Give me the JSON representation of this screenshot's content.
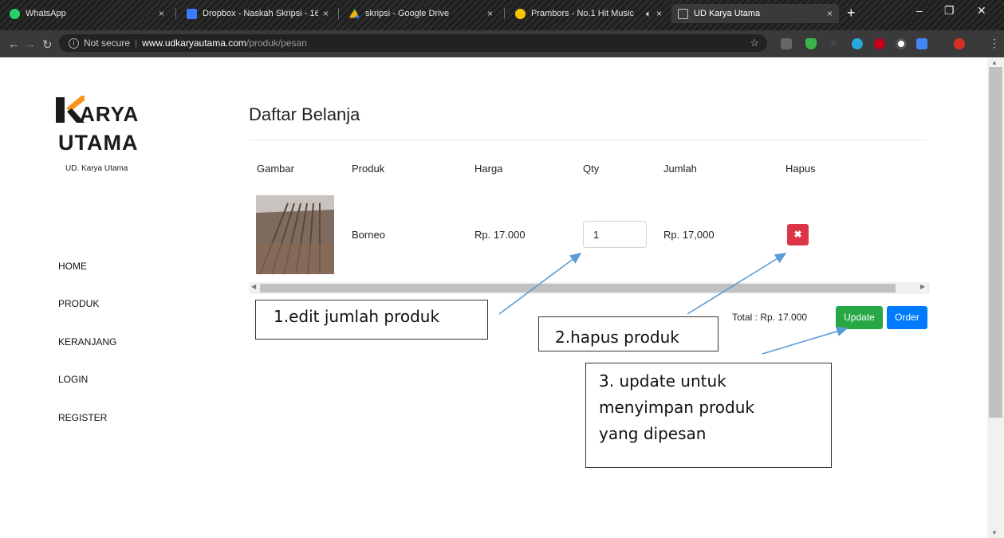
{
  "browser": {
    "tabs": [
      {
        "title": "WhatsApp",
        "favicon": "whatsapp-icon",
        "color": "#25d366"
      },
      {
        "title": "Dropbox - Naskah Skripsi - 16",
        "favicon": "dropbox-icon",
        "color": "#3d7bff"
      },
      {
        "title": "skripsi - Google Drive",
        "favicon": "google-drive-icon",
        "color": "#f4b400"
      },
      {
        "title": "Prambors - No.1 Hit Music",
        "favicon": "prambors-icon",
        "color": "#f7c600"
      },
      {
        "title": "UD Karya Utama",
        "favicon": "page-icon",
        "color": "#cccccc"
      }
    ],
    "url_security": "Not secure",
    "url_host": "www.udkaryautama.com",
    "url_path": "/produk/pesan"
  },
  "sidebar": {
    "logo_line1": "ARYA",
    "logo_line2": "UTAMA",
    "logo_sub": "UD. Karya Utama",
    "nav": [
      {
        "label": "HOME"
      },
      {
        "label": "PRODUK"
      },
      {
        "label": "KERANJANG"
      },
      {
        "label": "LOGIN"
      },
      {
        "label": "REGISTER"
      }
    ]
  },
  "main": {
    "title": "Daftar Belanja",
    "columns": [
      "Gambar",
      "Produk",
      "Harga",
      "Qty",
      "Jumlah",
      "Hapus"
    ],
    "rows": [
      {
        "product": "Borneo",
        "price": "Rp. 17.000",
        "qty": "1",
        "amount": "Rp. 17,000"
      }
    ],
    "total": "Total : Rp. 17.000",
    "update_label": "Update",
    "order_label": "Order",
    "colors": {
      "update": "#28a745",
      "order": "#007bff",
      "delete": "#dc3545"
    }
  },
  "annotations": {
    "c1": "1.edit jumlah produk",
    "c2": "2.hapus produk",
    "c3_l1": "3. update untuk",
    "c3_l2": "menyimpan produk",
    "c3_l3": "yang dipesan"
  }
}
